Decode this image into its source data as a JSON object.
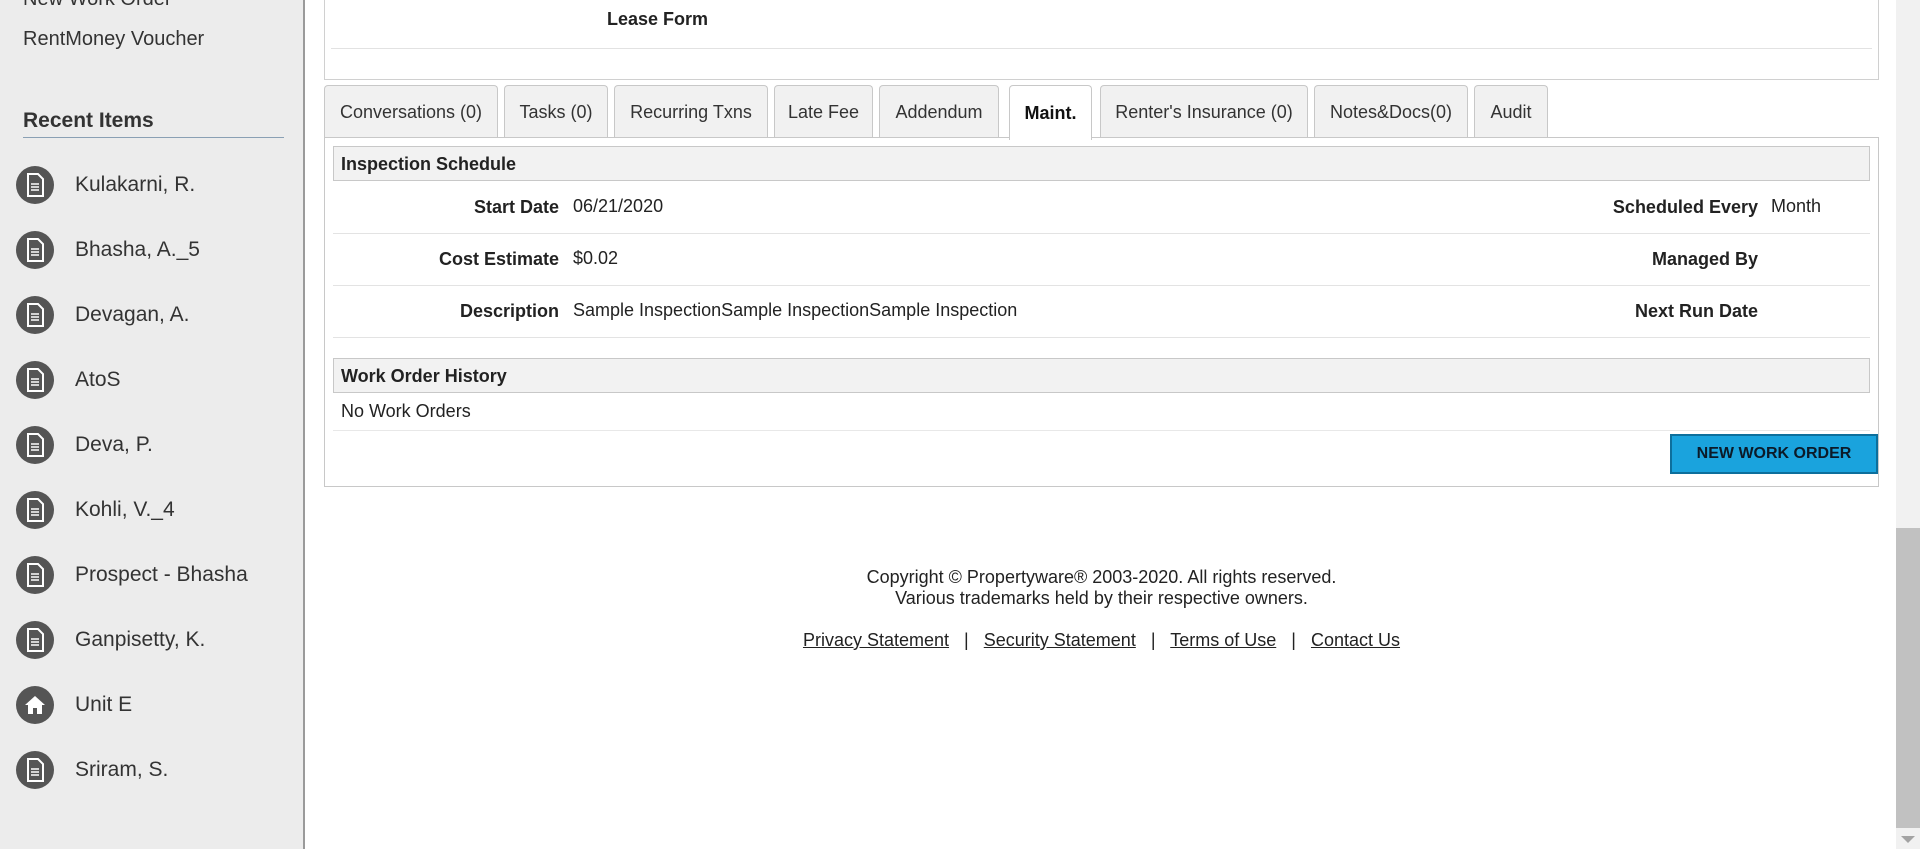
{
  "sidebar": {
    "partial_link": "New Work Order",
    "link": "RentMoney Voucher",
    "recent_heading": "Recent Items",
    "recent_items": [
      {
        "label": "Kulakarni, R.",
        "icon": "document-icon"
      },
      {
        "label": "Bhasha, A._5",
        "icon": "document-icon"
      },
      {
        "label": "Devagan, A.",
        "icon": "document-icon"
      },
      {
        "label": "AtoS",
        "icon": "document-icon"
      },
      {
        "label": "Deva, P.",
        "icon": "document-icon"
      },
      {
        "label": "Kohli, V._4",
        "icon": "document-icon"
      },
      {
        "label": "Prospect - Bhasha",
        "icon": "document-icon"
      },
      {
        "label": "Ganpisetty, K.",
        "icon": "document-icon"
      },
      {
        "label": "Unit E",
        "icon": "home-icon"
      },
      {
        "label": "Sriram, S.",
        "icon": "document-icon"
      }
    ]
  },
  "lease": {
    "form_label": "Lease Form"
  },
  "tabs": [
    {
      "label": "Conversations (0)"
    },
    {
      "label": "Tasks (0)"
    },
    {
      "label": "Recurring Txns"
    },
    {
      "label": "Late Fee"
    },
    {
      "label": "Addendum"
    },
    {
      "label": "Maint.",
      "active": true
    },
    {
      "label": "Renter's Insurance (0)"
    },
    {
      "label": "Notes&Docs(0)"
    },
    {
      "label": "Audit"
    }
  ],
  "inspection": {
    "heading": "Inspection Schedule",
    "start_date_label": "Start Date",
    "start_date": "06/21/2020",
    "scheduled_every_label": "Scheduled Every",
    "scheduled_every": "Month",
    "cost_estimate_label": "Cost Estimate",
    "cost_estimate": "$0.02",
    "managed_by_label": "Managed By",
    "managed_by": "",
    "description_label": "Description",
    "description": "Sample InspectionSample InspectionSample Inspection",
    "next_run_label": "Next Run Date",
    "next_run": ""
  },
  "work_orders": {
    "heading": "Work Order History",
    "empty_text": "No Work Orders",
    "new_button": "NEW WORK ORDER"
  },
  "footer": {
    "copyright": "Copyright © Propertyware® 2003-2020. All rights reserved.",
    "trademarks": "Various trademarks held by their respective owners.",
    "links": [
      "Privacy Statement",
      "Security Statement",
      "Terms of Use",
      "Contact Us"
    ],
    "separator": "|"
  },
  "colors": {
    "sidebar_bg": "#ececec",
    "button_bg": "#1aa3dd",
    "icon_circle": "#555555"
  }
}
